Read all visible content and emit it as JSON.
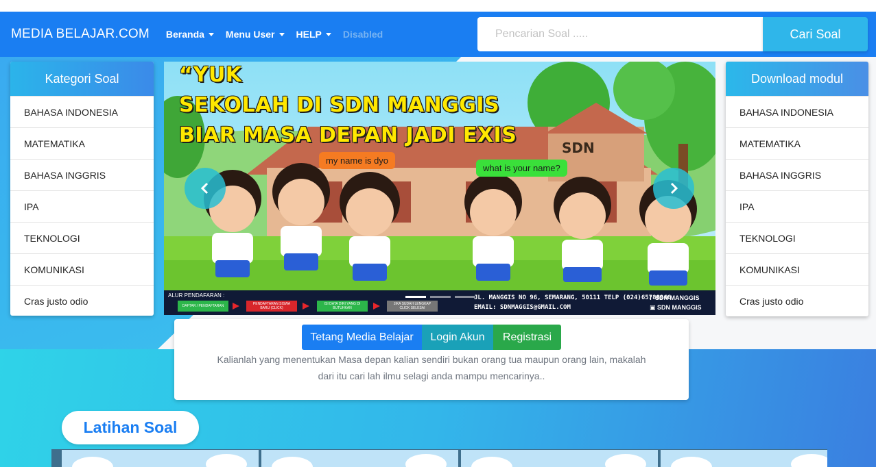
{
  "nav": {
    "brand": "MEDIA BELAJAR.COM",
    "items": [
      {
        "label": "Beranda"
      },
      {
        "label": "Menu User"
      },
      {
        "label": "HELP"
      }
    ],
    "disabled_label": "Disabled",
    "search_placeholder": "Pencarian Soal .....",
    "search_button": "Cari Soal"
  },
  "left_panel": {
    "title": "Kategori Soal",
    "items": [
      "BAHASA INDONESIA",
      "MATEMATIKA",
      "BAHASA INGGRIS",
      "IPA",
      "TEKNOLOGI",
      "KOMUNIKASI",
      "Cras justo odio"
    ]
  },
  "right_panel": {
    "title": "Download modul",
    "items": [
      "BAHASA INDONESIA",
      "MATEMATIKA",
      "BAHASA INGGRIS",
      "IPA",
      "TEKNOLOGI",
      "KOMUNIKASI",
      "Cras justo odio"
    ]
  },
  "carousel": {
    "headline_1": "“YUK",
    "headline_2": "SEKOLAH DI SDN MANGGIS",
    "headline_3": "BIAR MASA DEPAN JADI EXIS",
    "bubble_left": "my name is dyo",
    "bubble_right": "what is your name?",
    "sign": "SDN",
    "footer_title": "ALUR PENDAFARAN :",
    "steps": [
      "DAFTAR / PENDAFTARAN",
      "PENDAFTARAN SISWA BARU (CLICK)",
      "ISI DATA DIRI YANG DI BUTUHKAN",
      "JIKA SUDAH LENGKAP CLICK SELESAI"
    ],
    "address_1": "JL. MANGGIS NO 96, SEMARANG, 50111 TELP (024)65788946",
    "address_2": "EMAIL: SDNMAGGIS@GMAIL.COM",
    "social_1": "SDN MANGGIS",
    "social_2": "SDN MANGGIS",
    "prev_icon": "chevron-left-icon",
    "next_icon": "chevron-right-icon"
  },
  "info": {
    "buttons": [
      "Tetang Media Belajar",
      "Login Akun",
      "Registrasi"
    ],
    "text_line_1": "Kalianlah yang menentukan Masa depan kalian sendiri bukan orang tua maupun orang lain, makalah",
    "text_line_2": "dari itu cari lah ilmu selagi anda mampu mencarinya.."
  },
  "latihan": {
    "title": "Latihan Soal"
  },
  "colors": {
    "navbar": "#1a7ef2",
    "accent": "#2fb6ea",
    "success": "#2aa84a",
    "info": "#1aa1b8"
  }
}
